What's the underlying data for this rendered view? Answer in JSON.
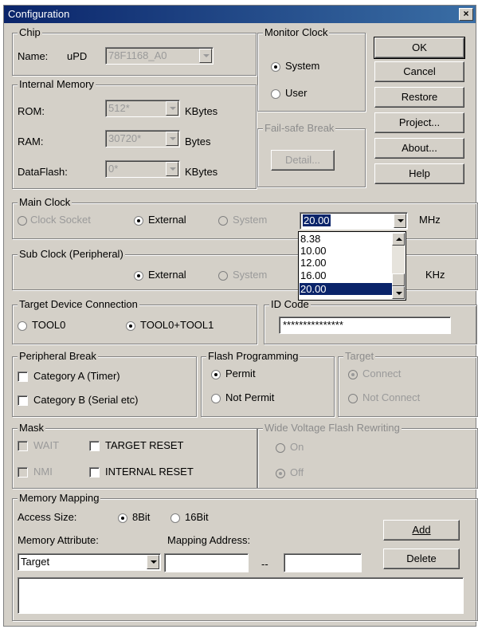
{
  "window": {
    "title": "Configuration",
    "close_label": "×"
  },
  "chip": {
    "legend": "Chip",
    "name_label": "Name:",
    "prefix": "uPD",
    "value": "78F1168_A0"
  },
  "monitor_clock": {
    "legend": "Monitor Clock",
    "options": [
      "System",
      "User"
    ],
    "selected": "System"
  },
  "buttons": {
    "ok": "OK",
    "cancel": "Cancel",
    "restore": "Restore",
    "project": "Project...",
    "about": "About...",
    "help": "Help"
  },
  "internal_memory": {
    "legend": "Internal Memory",
    "rom": {
      "label": "ROM:",
      "value": "512*",
      "unit": "KBytes"
    },
    "ram": {
      "label": "RAM:",
      "value": "30720*",
      "unit": "Bytes"
    },
    "dataflash": {
      "label": "DataFlash:",
      "value": "0*",
      "unit": "KBytes"
    }
  },
  "fail_safe": {
    "legend": "Fail-safe Break",
    "detail_label": "Detail..."
  },
  "main_clock": {
    "legend": "Main Clock",
    "options": [
      "Clock Socket",
      "External",
      "System"
    ],
    "selected": "External",
    "value": "20.00",
    "unit": "MHz",
    "dropdown_items": [
      "8.38",
      "10.00",
      "12.00",
      "16.00",
      "20.00"
    ],
    "dropdown_selected": "20.00"
  },
  "sub_clock": {
    "legend": "Sub Clock (Peripheral)",
    "options": [
      "External",
      "System"
    ],
    "selected": "External",
    "unit": "KHz"
  },
  "target_device": {
    "legend": "Target Device Connection",
    "options": [
      "TOOL0",
      "TOOL0+TOOL1"
    ],
    "selected": "TOOL0+TOOL1"
  },
  "id_code": {
    "legend": "ID Code",
    "value": "***************"
  },
  "peripheral_break": {
    "legend": "Peripheral Break",
    "items": [
      "Category A (Timer)",
      "Category B (Serial etc)"
    ]
  },
  "flash_programming": {
    "legend": "Flash Programming",
    "options": [
      "Permit",
      "Not Permit"
    ],
    "selected": "Permit"
  },
  "target": {
    "legend": "Target",
    "options": [
      "Connect",
      "Not Connect"
    ],
    "selected": "Connect"
  },
  "mask": {
    "legend": "Mask",
    "items": [
      "WAIT",
      "TARGET RESET",
      "NMI",
      "INTERNAL RESET"
    ]
  },
  "wide_voltage": {
    "legend": "Wide Voltage Flash Rewriting",
    "options": [
      "On",
      "Off"
    ],
    "selected": "Off"
  },
  "memory_mapping": {
    "legend": "Memory Mapping",
    "access_size_label": "Access Size:",
    "access_options": [
      "8Bit",
      "16Bit"
    ],
    "access_selected": "8Bit",
    "attribute_label": "Memory Attribute:",
    "attribute_value": "Target",
    "address_label": "Mapping Address:",
    "separator": "--",
    "add_label": "Add",
    "delete_label": "Delete"
  }
}
